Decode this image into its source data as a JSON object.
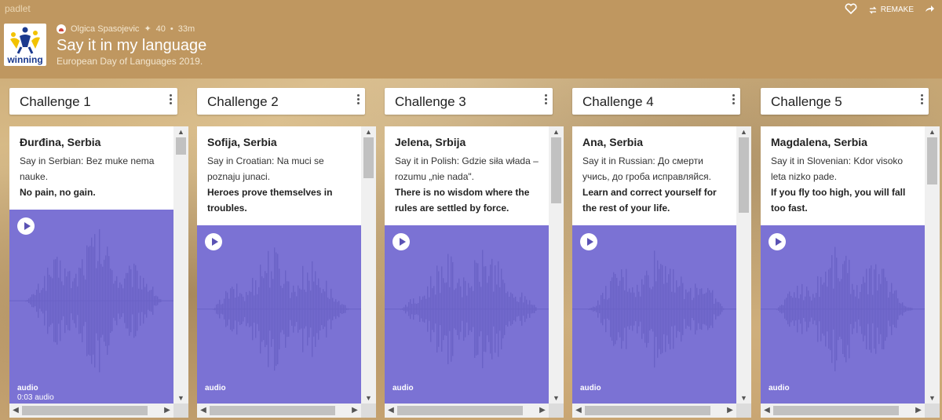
{
  "header": {
    "brand": "padlet",
    "logo_text": "winning",
    "author": "Olgica Spasojevic",
    "likes": "40",
    "time_ago": "33m",
    "title": "Say it in my language",
    "subtitle": "European Day of Languages 2019.",
    "remake_label": "REMAKE",
    "icons": [
      "heart-icon",
      "remake-icon",
      "share-icon"
    ]
  },
  "columns": [
    {
      "title": "Challenge 1",
      "author": "Đurđina, Serbia",
      "body": "Say in Serbian: Bez muke nema nauke.",
      "english": "No pain, no gain.",
      "audio_label": "audio",
      "audio_duration": "0:03 audio"
    },
    {
      "title": "Challenge 2",
      "author": "Sofija, Serbia",
      "body": "Say in Croatian: Na muci se poznaju junaci.",
      "english": "Heroes prove themselves in troubles.",
      "audio_label": "audio",
      "audio_duration": ""
    },
    {
      "title": "Challenge 3",
      "author": "Jelena, Srbija",
      "body": "Say it in Polish: Gdzie siła włada – rozumu „nie nada\".",
      "english": "There is no wisdom where the rules are settled by force.",
      "audio_label": "audio",
      "audio_duration": ""
    },
    {
      "title": "Challenge 4",
      "author": "Ana, Serbia",
      "body": "Say it in Russian: До смерти учись, до гроба исправляйся.",
      "english": "Learn and correct yourself for the rest of your life.",
      "audio_label": "audio",
      "audio_duration": ""
    },
    {
      "title": "Challenge 5",
      "author": "Magdalena, Serbia",
      "body": "Say it in Slovenian: Kdor visoko leta nizko pade.",
      "english": "If you fly too high, you will fall too fast.",
      "audio_label": "audio",
      "audio_duration": ""
    }
  ],
  "colors": {
    "header": "#bf9760",
    "audio": "#7b72d4",
    "wave": "#6a62c6"
  }
}
